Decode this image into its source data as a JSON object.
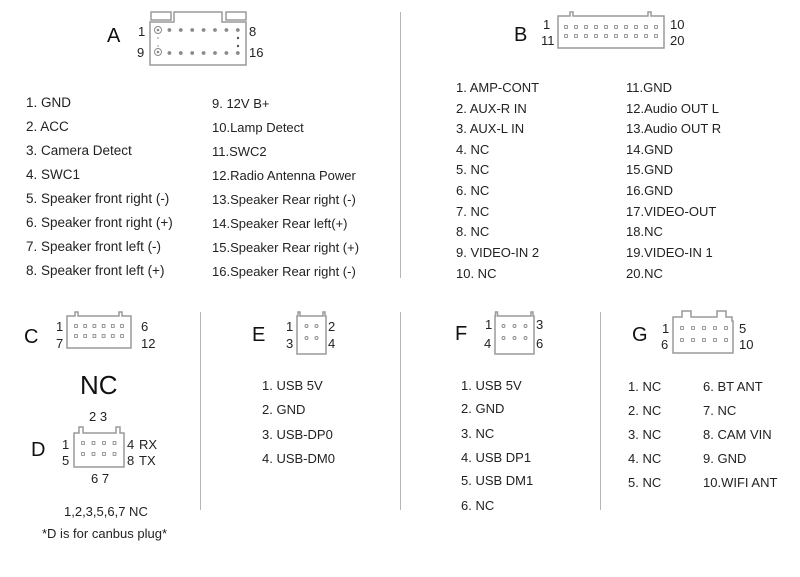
{
  "connectors": {
    "A": {
      "letter": "A",
      "pin_top_left": "1",
      "pin_top_right": "8",
      "pin_bottom_left": "9",
      "pin_bottom_right": "16",
      "pins_left": [
        "1. GND",
        "2. ACC",
        "3. Camera Detect",
        "4. SWC1",
        "5. Speaker front right (-)",
        "6. Speaker front right (+)",
        "7. Speaker front left (-)",
        "8. Speaker front left (+)"
      ],
      "pins_right": [
        "9.  12V B+",
        "10.Lamp Detect",
        "11.SWC2",
        "12.Radio Antenna Power",
        "13.Speaker Rear right (-)",
        "14.Speaker Rear left(+)",
        "15.Speaker Rear right (+)",
        "16.Speaker Rear right (-)"
      ]
    },
    "B": {
      "letter": "B",
      "pin_top_left": "1",
      "pin_top_right": "10",
      "pin_bottom_left": "11",
      "pin_bottom_right": "20",
      "pins_left": [
        "1.  AMP-CONT",
        "2.  AUX-R IN",
        "3.  AUX-L IN",
        "4.  NC",
        "5.  NC",
        "6.  NC",
        "7.  NC",
        "8.  NC",
        "9. VIDEO-IN 2",
        "10.  NC"
      ],
      "pins_right": [
        "11.GND",
        "12.Audio OUT  L",
        "13.Audio OUT  R",
        "14.GND",
        "15.GND",
        "16.GND",
        "17.VIDEO-OUT",
        "18.NC",
        "19.VIDEO-IN 1",
        "20.NC"
      ]
    },
    "C": {
      "letter": "C",
      "pin_top_left": "1",
      "pin_top_right": "6",
      "pin_bottom_left": "7",
      "pin_bottom_right": "12",
      "status": "NC"
    },
    "D": {
      "letter": "D",
      "pin_top_labels": "2 3",
      "pin_bottom_labels": "6 7",
      "pin_top_left": "1",
      "pin_top_right": "4",
      "pin_bottom_left": "5",
      "pin_bottom_right": "8",
      "pin_top_right_signal": "RX",
      "pin_bottom_right_signal": "TX",
      "nc_note": "1,2,3,5,6,7  NC",
      "footnote": "*D is for canbus plug*"
    },
    "E": {
      "letter": "E",
      "pin_top_left": "1",
      "pin_top_right": "2",
      "pin_bottom_left": "3",
      "pin_bottom_right": "4",
      "pins": [
        "1. USB 5V",
        "2. GND",
        "3. USB-DP0",
        "4. USB-DM0"
      ]
    },
    "F": {
      "letter": "F",
      "pin_top_left": "1",
      "pin_top_right": "3",
      "pin_bottom_left": "4",
      "pin_bottom_right": "6",
      "pins": [
        "1. USB 5V",
        "2. GND",
        "3. NC",
        "4. USB DP1",
        "5. USB DM1",
        "6. NC"
      ]
    },
    "G": {
      "letter": "G",
      "pin_top_left": "1",
      "pin_top_right": "5",
      "pin_bottom_left": "6",
      "pin_bottom_right": "10",
      "pins_left": [
        "1. NC",
        "2. NC",
        "3. NC",
        "4. NC",
        "5. NC"
      ],
      "pins_right": [
        "6.  BT ANT",
        "7.  NC",
        "8.  CAM VIN",
        "9.  GND",
        "10.WIFI ANT"
      ]
    }
  },
  "colors": {
    "outline": "#9a9a9a",
    "pin": "#8a8a8a",
    "divider": "#b5b5b5",
    "text": "#222222"
  }
}
